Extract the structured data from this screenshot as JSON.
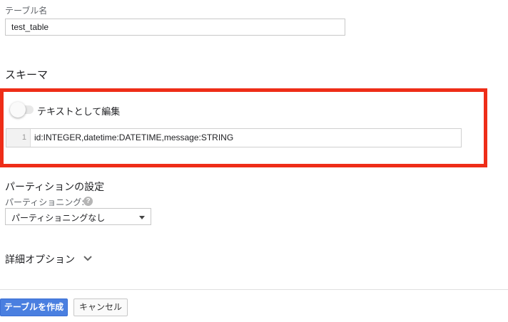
{
  "table_name": {
    "label": "テーブル名",
    "value": "test_table"
  },
  "schema": {
    "title": "スキーマ",
    "toggle_label": "テキストとして編集",
    "toggle_on": false,
    "editor": {
      "line_number": "1",
      "text": "id:INTEGER,datetime:DATETIME,message:STRING"
    },
    "highlight_color": "#ee2d18"
  },
  "partition": {
    "title": "パーティションの設定",
    "label": "パーティショニング:",
    "help_icon": "?",
    "select_value": "パーティショニングなし"
  },
  "advanced": {
    "label": "詳細オプション"
  },
  "footer": {
    "create_label": "テーブルを作成",
    "cancel_label": "キャンセル",
    "primary_color": "#4a7fe0"
  }
}
